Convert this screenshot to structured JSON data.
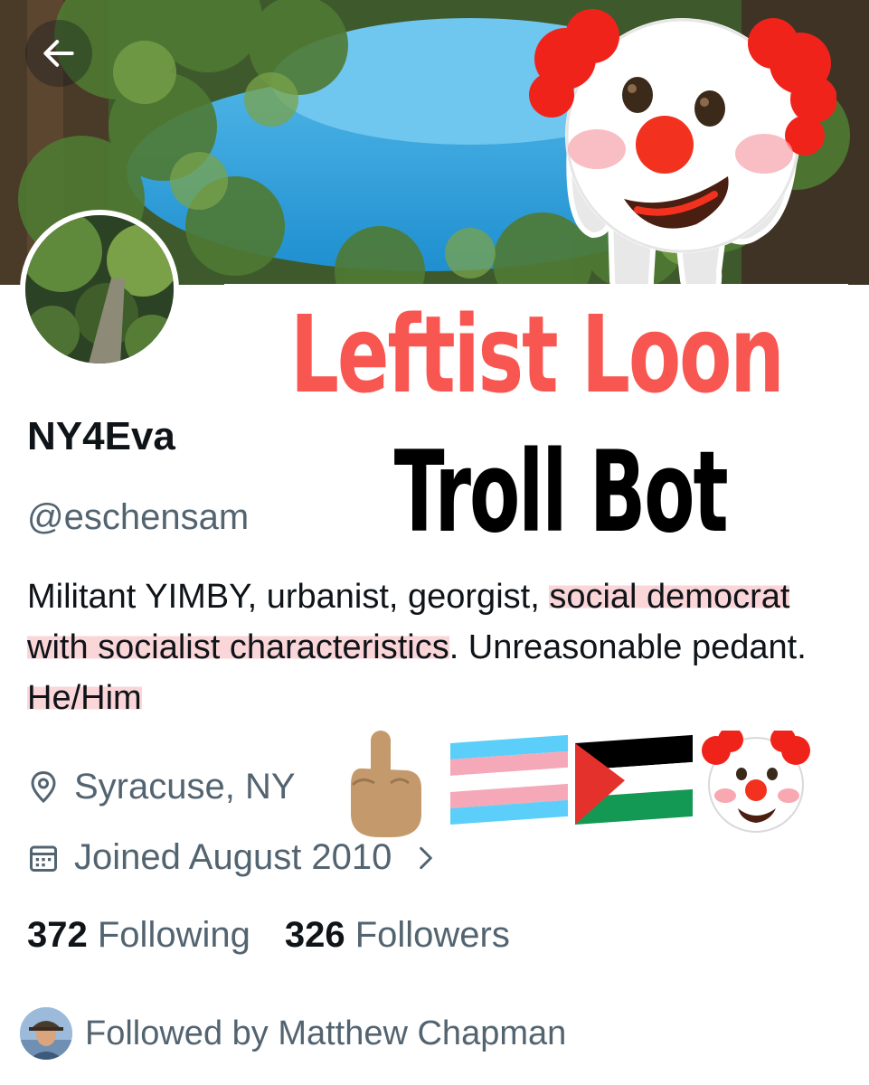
{
  "overlay": {
    "headline": "Leftist Loon",
    "subheadline": "Troll Bot"
  },
  "profile": {
    "display_name": "NY4Eva",
    "handle": "@eschensam",
    "bio": {
      "part1": "Militant YIMBY, urbanist, georgist, ",
      "highlight1": "social democrat with socialist characteristics",
      "part2": ". Unreasonable pedant. ",
      "highlight2": "He/Him"
    },
    "location": "Syracuse, NY",
    "joined": "Joined August 2010",
    "following_count": "372",
    "following_label": "Following",
    "followers_count": "326",
    "followers_label": "Followers",
    "followed_by": "Followed by Matthew Chapman"
  },
  "icons": {
    "back": "arrow-left-icon",
    "more": "more-vertical-icon",
    "location": "location-pin-icon",
    "calendar": "calendar-icon",
    "chevron": "chevron-right-icon",
    "emojis": [
      "middle-finger-emoji",
      "transgender-flag-emoji",
      "palestine-flag-emoji",
      "clown-face-emoji"
    ]
  },
  "colors": {
    "headline": "#f85651",
    "subheadline": "#000000",
    "secondary_text": "#536471",
    "primary_text": "#0f1419",
    "highlight": "#f8b4b9"
  }
}
